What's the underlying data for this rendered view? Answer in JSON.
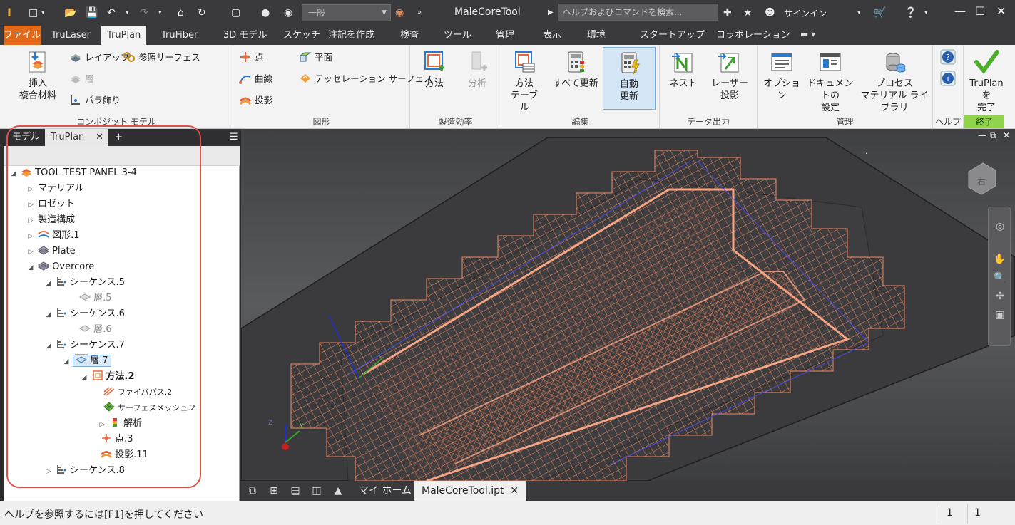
{
  "titlebar": {
    "style_combo": "一般",
    "app_title": "MaleCoreTool",
    "help_search_placeholder": "ヘルプおよびコマンドを検索...",
    "signin": "サインイン"
  },
  "tabs": [
    {
      "label": "ファイル"
    },
    {
      "label": "TruLaser"
    },
    {
      "label": "TruPlan"
    },
    {
      "label": "TruFiber"
    },
    {
      "label": "3D モデル"
    },
    {
      "label": "スケッチ"
    },
    {
      "label": "注記を作成"
    },
    {
      "label": "検査"
    },
    {
      "label": "ツール"
    },
    {
      "label": "管理"
    },
    {
      "label": "表示"
    },
    {
      "label": "環境"
    },
    {
      "label": "スタートアップ"
    },
    {
      "label": "コラボレーション"
    }
  ],
  "ribbon": {
    "composite": {
      "label": "コンポジット モデル",
      "insert_line1": "挿入",
      "insert_line2": "複合材料",
      "layup": "レイアップ",
      "layer": "層",
      "pare": "パラ飾り",
      "ref_surface": "参照サーフェス"
    },
    "shape": {
      "label": "図形",
      "point": "点",
      "curve": "曲線",
      "projection": "投影",
      "plane": "平面",
      "tessellation": "テッセレーション サーフェス"
    },
    "efficiency": {
      "label": "製造効率",
      "method": "方法",
      "analysis": "分析"
    },
    "edit": {
      "label": "編集",
      "method_table_1": "方法",
      "method_table_2": "テーブル",
      "update_all": "すべて更新",
      "auto_update_1": "自動",
      "auto_update_2": "更新"
    },
    "output": {
      "label": "データ出力",
      "nest": "ネスト",
      "laser_1": "レーザー",
      "laser_2": "投影"
    },
    "manage": {
      "label": "管理",
      "options": "オプション",
      "doc_settings_1": "ドキュメントの",
      "doc_settings_2": "設定",
      "process_1": "プロセス",
      "process_2": "マテリアル ライブラリ"
    },
    "help": {
      "label": "ヘルプ"
    },
    "finish": {
      "label": "終了",
      "finish_1": "TruPlan を",
      "finish_2": "完了"
    }
  },
  "browser": {
    "tab_model": "モデル",
    "tab_truplan": "TruPlan",
    "add_tab": "+",
    "tree": [
      {
        "label": "TOOL TEST PANEL 3-4"
      },
      {
        "label": "マテリアル"
      },
      {
        "label": "ロゼット"
      },
      {
        "label": "製造構成"
      },
      {
        "label": "図形.1"
      },
      {
        "label": "Plate"
      },
      {
        "label": "Overcore"
      },
      {
        "label": "シーケンス.5"
      },
      {
        "label": "層.5"
      },
      {
        "label": "シーケンス.6"
      },
      {
        "label": "層.6"
      },
      {
        "label": "シーケンス.7"
      },
      {
        "label": "層.7"
      },
      {
        "label": "方法.2"
      },
      {
        "label": "ファイバパス.2"
      },
      {
        "label": "サーフェスメッシュ.2"
      },
      {
        "label": "解析"
      },
      {
        "label": "点.3"
      },
      {
        "label": "投影.11"
      },
      {
        "label": "シーケンス.8"
      }
    ]
  },
  "viewcube_label": "右",
  "doc_tabs": {
    "home": "マイ ホーム",
    "file": "MaleCoreTool.ipt"
  },
  "statusbar": {
    "help_text": "ヘルプを参照するには[F1]を押してください",
    "count1": "1",
    "count2": "1"
  },
  "colors": {
    "file_tab": "#e06a19",
    "active_tab": "#8fd44a",
    "mesh": "#f08a64",
    "annotation_ring": "#e0504a"
  }
}
